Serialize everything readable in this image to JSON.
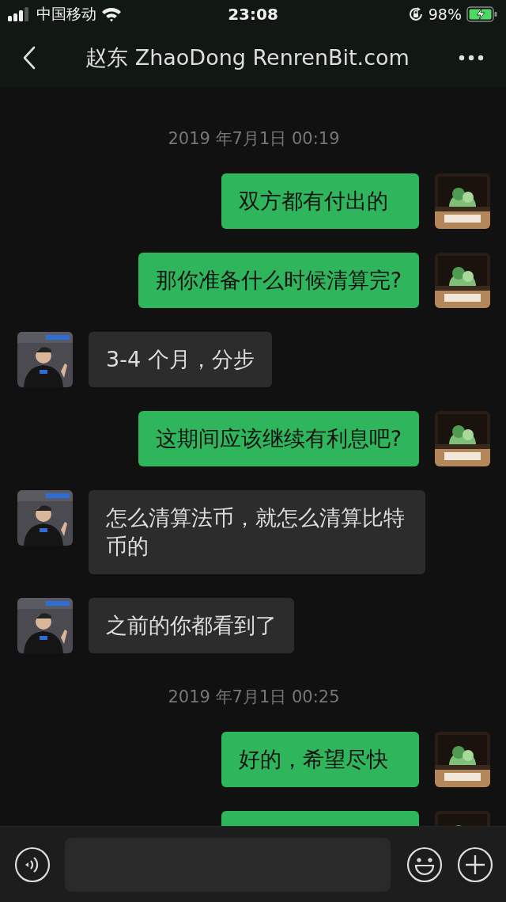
{
  "status_bar": {
    "carrier": "中国移动",
    "time": "23:08",
    "battery": "98%"
  },
  "header": {
    "title": "赵东 ZhaoDong RenrenBit.com"
  },
  "messages": [
    {
      "kind": "time",
      "text": "2019 年7月1日 00:19"
    },
    {
      "kind": "sent",
      "text": "双方都有付出的"
    },
    {
      "kind": "sent",
      "text": "那你准备什么时候清算完?"
    },
    {
      "kind": "received",
      "text": "3-4 个月，分步"
    },
    {
      "kind": "sent",
      "text": "这期间应该继续有利息吧?"
    },
    {
      "kind": "received",
      "text": "怎么清算法币，就怎么清算比特币的"
    },
    {
      "kind": "received",
      "text": "之前的你都看到了"
    },
    {
      "kind": "time",
      "text": "2019 年7月1日 00:25"
    },
    {
      "kind": "sent",
      "text": "好的，希望尽快"
    },
    {
      "kind": "sent"
    }
  ]
}
